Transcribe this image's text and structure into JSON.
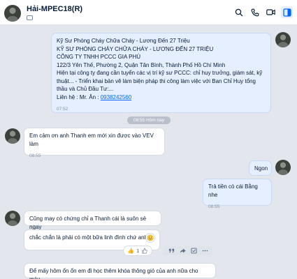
{
  "header": {
    "name": "Hải-MPEC18(R)",
    "icons": [
      "search-icon",
      "phone-icon",
      "video-icon",
      "sidebar-toggle-icon"
    ]
  },
  "messages": [
    {
      "id": "job-post",
      "direction": "out",
      "lines": [
        "Kỹ Sư Phòng Cháy Chữa Cháy - Lương Đến 27 Triệu",
        "KỸ SƯ PHÒNG CHÁY CHỮA CHÁY - LƯƠNG ĐẾN 27 TRIỆU",
        "CÔNG TY TNHH PCCC GIA PHÚ",
        "122/3 Yên Thế, Phường 2, Quận Tân Bình, Thành Phố Hồ Chí Minh",
        "Hiện tại công ty đang cần tuyển các vị trí kỹ sư PCCC: chỉ huy trưởng, giám sát, kỹ thuật... - Triển khai bản vẽ làm biện pháp thi công làm việc với Ban Chỉ Huy tổng thầu và Chủ Đầu Tư:..."
      ],
      "contact_label": "Liên hệ : Mr. Ân : ",
      "contact_phone": "0938242560",
      "time": "07:52"
    },
    {
      "id": "thanks",
      "direction": "in",
      "text": "Em cảm  ơn anh Thanh em mới xin được vào VEV làm",
      "time": "08:55"
    },
    {
      "id": "ngon",
      "direction": "out",
      "text": "Ngon"
    },
    {
      "id": "tra-tien",
      "direction": "out",
      "text": "Trả tiền cò cái Bằng nhe",
      "time": "08:55"
    },
    {
      "id": "cung-may",
      "direction": "in",
      "text": "Cũng may có chứng chỉ a Thanh cái là suôn sẻ ngay"
    },
    {
      "id": "chac-chan",
      "direction": "in",
      "text": "chắc chắn là phải có một bữa linh đình chứ anh"
    },
    {
      "id": "de-may",
      "direction": "in",
      "text": "Để mấy hôm ổn ổn em đi học thêm khóa thông gió của anh nữa cho máu"
    }
  ],
  "date_separator": "08:55 Hôm nay",
  "reactions": {
    "emoji": "👍",
    "count": "1"
  },
  "colors": {
    "outgoing_bubble": "#e5efff",
    "incoming_bubble": "#ffffff",
    "background": "#e3e6ec",
    "link": "#0068ff",
    "accent": "#0068ff"
  }
}
